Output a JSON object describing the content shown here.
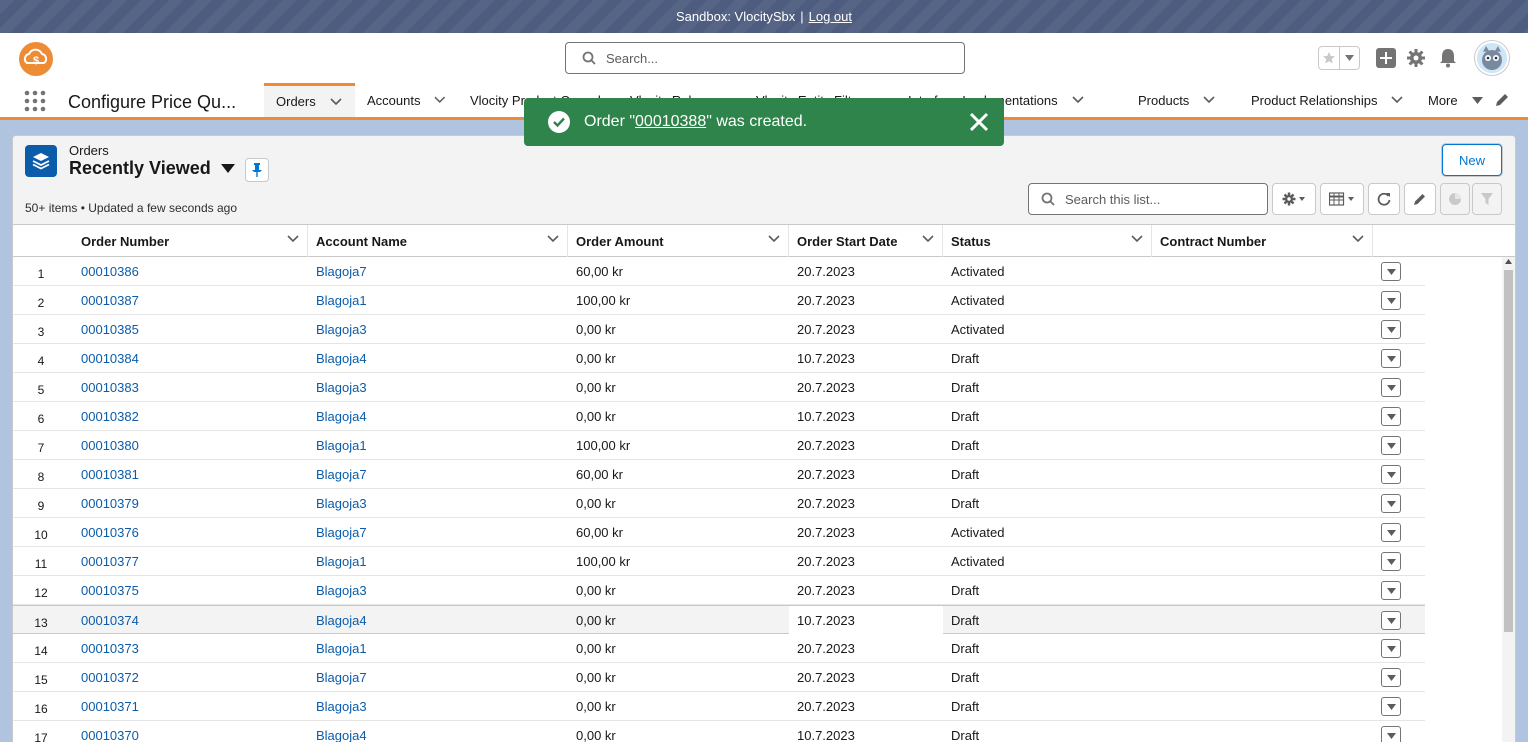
{
  "sandbox": {
    "text": "Sandbox: VlocitySbx",
    "separator": "|",
    "logout": "Log out"
  },
  "search": {
    "placeholder": "Search..."
  },
  "app": {
    "name": "Configure Price Qu..."
  },
  "nav": {
    "items": [
      {
        "label": "Orders",
        "active": true
      },
      {
        "label": "Accounts"
      },
      {
        "label": "Vlocity Product Console"
      },
      {
        "label": "Vlocity Rules"
      },
      {
        "label": "Vlocity Entity Filters"
      },
      {
        "label": "Interface Implementations"
      },
      {
        "label": "Products"
      },
      {
        "label": "Product Relationships"
      },
      {
        "label": "More"
      }
    ]
  },
  "toast": {
    "prefix": "Order \"",
    "link": "00010388",
    "suffix": "\" was created."
  },
  "list": {
    "object_label": "Orders",
    "view_name": "Recently Viewed",
    "meta": "50+ items • Updated a few seconds ago",
    "new_button": "New",
    "search_placeholder": "Search this list..."
  },
  "table": {
    "columns": [
      "Order Number",
      "Account Name",
      "Order Amount",
      "Order Start Date",
      "Status",
      "Contract Number"
    ],
    "rows": [
      {
        "n": "1",
        "order": "00010386",
        "account": "Blagoja7",
        "amount": "60,00 kr",
        "date": "20.7.2023",
        "status": "Activated",
        "contract": ""
      },
      {
        "n": "2",
        "order": "00010387",
        "account": "Blagoja1",
        "amount": "100,00 kr",
        "date": "20.7.2023",
        "status": "Activated",
        "contract": ""
      },
      {
        "n": "3",
        "order": "00010385",
        "account": "Blagoja3",
        "amount": "0,00 kr",
        "date": "20.7.2023",
        "status": "Activated",
        "contract": ""
      },
      {
        "n": "4",
        "order": "00010384",
        "account": "Blagoja4",
        "amount": "0,00 kr",
        "date": "10.7.2023",
        "status": "Draft",
        "contract": ""
      },
      {
        "n": "5",
        "order": "00010383",
        "account": "Blagoja3",
        "amount": "0,00 kr",
        "date": "20.7.2023",
        "status": "Draft",
        "contract": ""
      },
      {
        "n": "6",
        "order": "00010382",
        "account": "Blagoja4",
        "amount": "0,00 kr",
        "date": "10.7.2023",
        "status": "Draft",
        "contract": ""
      },
      {
        "n": "7",
        "order": "00010380",
        "account": "Blagoja1",
        "amount": "100,00 kr",
        "date": "20.7.2023",
        "status": "Draft",
        "contract": ""
      },
      {
        "n": "8",
        "order": "00010381",
        "account": "Blagoja7",
        "amount": "60,00 kr",
        "date": "20.7.2023",
        "status": "Draft",
        "contract": ""
      },
      {
        "n": "9",
        "order": "00010379",
        "account": "Blagoja3",
        "amount": "0,00 kr",
        "date": "20.7.2023",
        "status": "Draft",
        "contract": ""
      },
      {
        "n": "10",
        "order": "00010376",
        "account": "Blagoja7",
        "amount": "60,00 kr",
        "date": "20.7.2023",
        "status": "Activated",
        "contract": ""
      },
      {
        "n": "11",
        "order": "00010377",
        "account": "Blagoja1",
        "amount": "100,00 kr",
        "date": "20.7.2023",
        "status": "Activated",
        "contract": ""
      },
      {
        "n": "12",
        "order": "00010375",
        "account": "Blagoja3",
        "amount": "0,00 kr",
        "date": "20.7.2023",
        "status": "Draft",
        "contract": ""
      },
      {
        "n": "13",
        "order": "00010374",
        "account": "Blagoja4",
        "amount": "0,00 kr",
        "date": "10.7.2023",
        "status": "Draft",
        "contract": "",
        "highlight": true
      },
      {
        "n": "14",
        "order": "00010373",
        "account": "Blagoja1",
        "amount": "0,00 kr",
        "date": "20.7.2023",
        "status": "Draft",
        "contract": ""
      },
      {
        "n": "15",
        "order": "00010372",
        "account": "Blagoja7",
        "amount": "0,00 kr",
        "date": "20.7.2023",
        "status": "Draft",
        "contract": ""
      },
      {
        "n": "16",
        "order": "00010371",
        "account": "Blagoja3",
        "amount": "0,00 kr",
        "date": "20.7.2023",
        "status": "Draft",
        "contract": ""
      },
      {
        "n": "17",
        "order": "00010370",
        "account": "Blagoja4",
        "amount": "0,00 kr",
        "date": "10.7.2023",
        "status": "Draft",
        "contract": ""
      }
    ]
  },
  "colors": {
    "brand": "#0176d3",
    "link": "#0b5cab",
    "toast": "#2e844a",
    "nav_accent": "#ee8b35"
  }
}
